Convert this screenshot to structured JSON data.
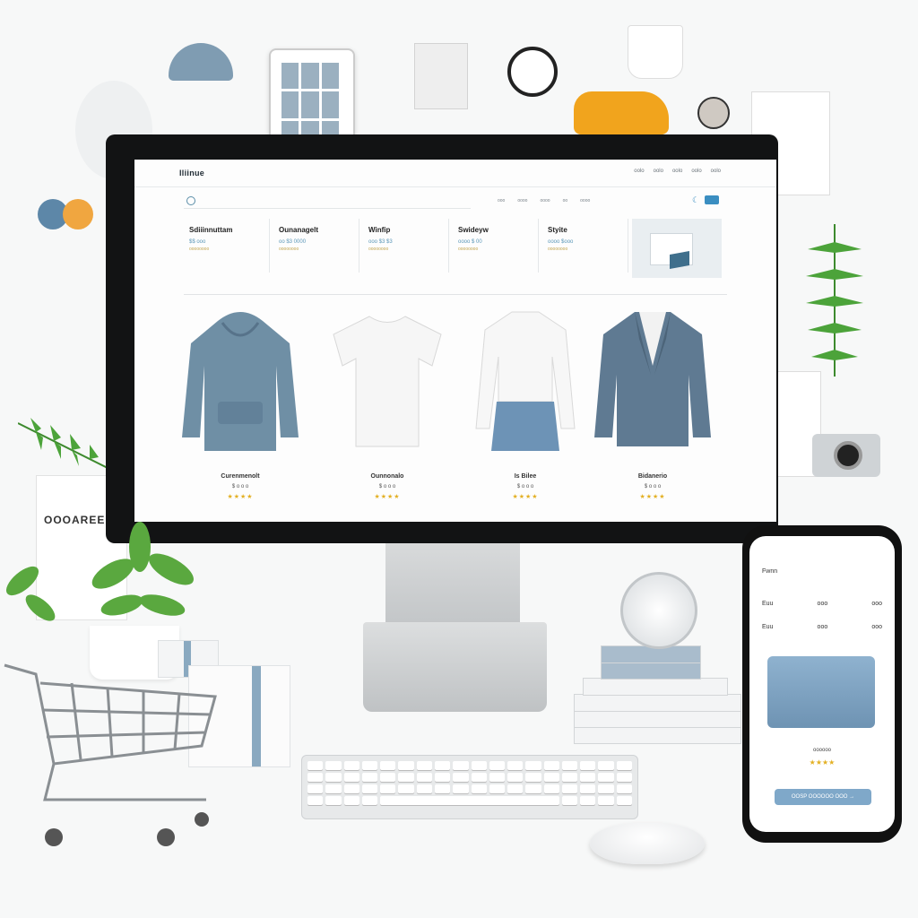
{
  "site": {
    "logo": "Iliinue",
    "nav": [
      "oolo",
      "oolo",
      "oolo",
      "oolo",
      "oolo"
    ],
    "categories": [
      "ooo",
      "oooo",
      "oooo",
      "oo",
      "oooo"
    ]
  },
  "filters": [
    {
      "title": "Sdiiinnuttam",
      "price": "$$ ooo",
      "sub": "oooooooo"
    },
    {
      "title": "Ounanagelt",
      "price": "oo $3 0000",
      "sub": "oooooooo"
    },
    {
      "title": "Winfip",
      "price": "ooo $3 $3",
      "sub": "oooooooo"
    },
    {
      "title": "Swideyw",
      "price": "oooo $ 00",
      "sub": "oooooooo"
    },
    {
      "title": "Styite",
      "price": "oooo $ooo",
      "sub": "oooooooo"
    }
  ],
  "products": [
    {
      "name": "Curenmenolt",
      "price": "$ o o o",
      "stars": "★★★★",
      "icon": "hoodie-icon",
      "color": "#6f8fa5"
    },
    {
      "name": "Ounnonalo",
      "price": "$ o o o",
      "stars": "★★★★",
      "icon": "tshirt-icon",
      "color": "#f2f2f2"
    },
    {
      "name": "Is Bilee",
      "price": "$ o o o",
      "stars": "★★★★",
      "icon": "blouse-icon",
      "color": "#f5f5f5"
    },
    {
      "name": "Bidanerio",
      "price": "$ o o o",
      "stars": "★★★★",
      "icon": "blazer-icon",
      "color": "#5f7a92"
    }
  ],
  "phone": {
    "header": "Fwnn",
    "rows": [
      {
        "label": "Euu",
        "a": "ooo",
        "b": "ooo"
      },
      {
        "label": "Euu",
        "a": "ooo",
        "b": "ooo"
      }
    ],
    "caption": "oooooo",
    "stars": "★★★★",
    "button": "OOSP OOOOOO OOO →"
  },
  "poster": {
    "title": "OOOAREEN"
  },
  "colors": {
    "accent": "#3b8ec1",
    "star": "#e3b023",
    "monitor": "#121314",
    "car": "#f1a41d"
  }
}
